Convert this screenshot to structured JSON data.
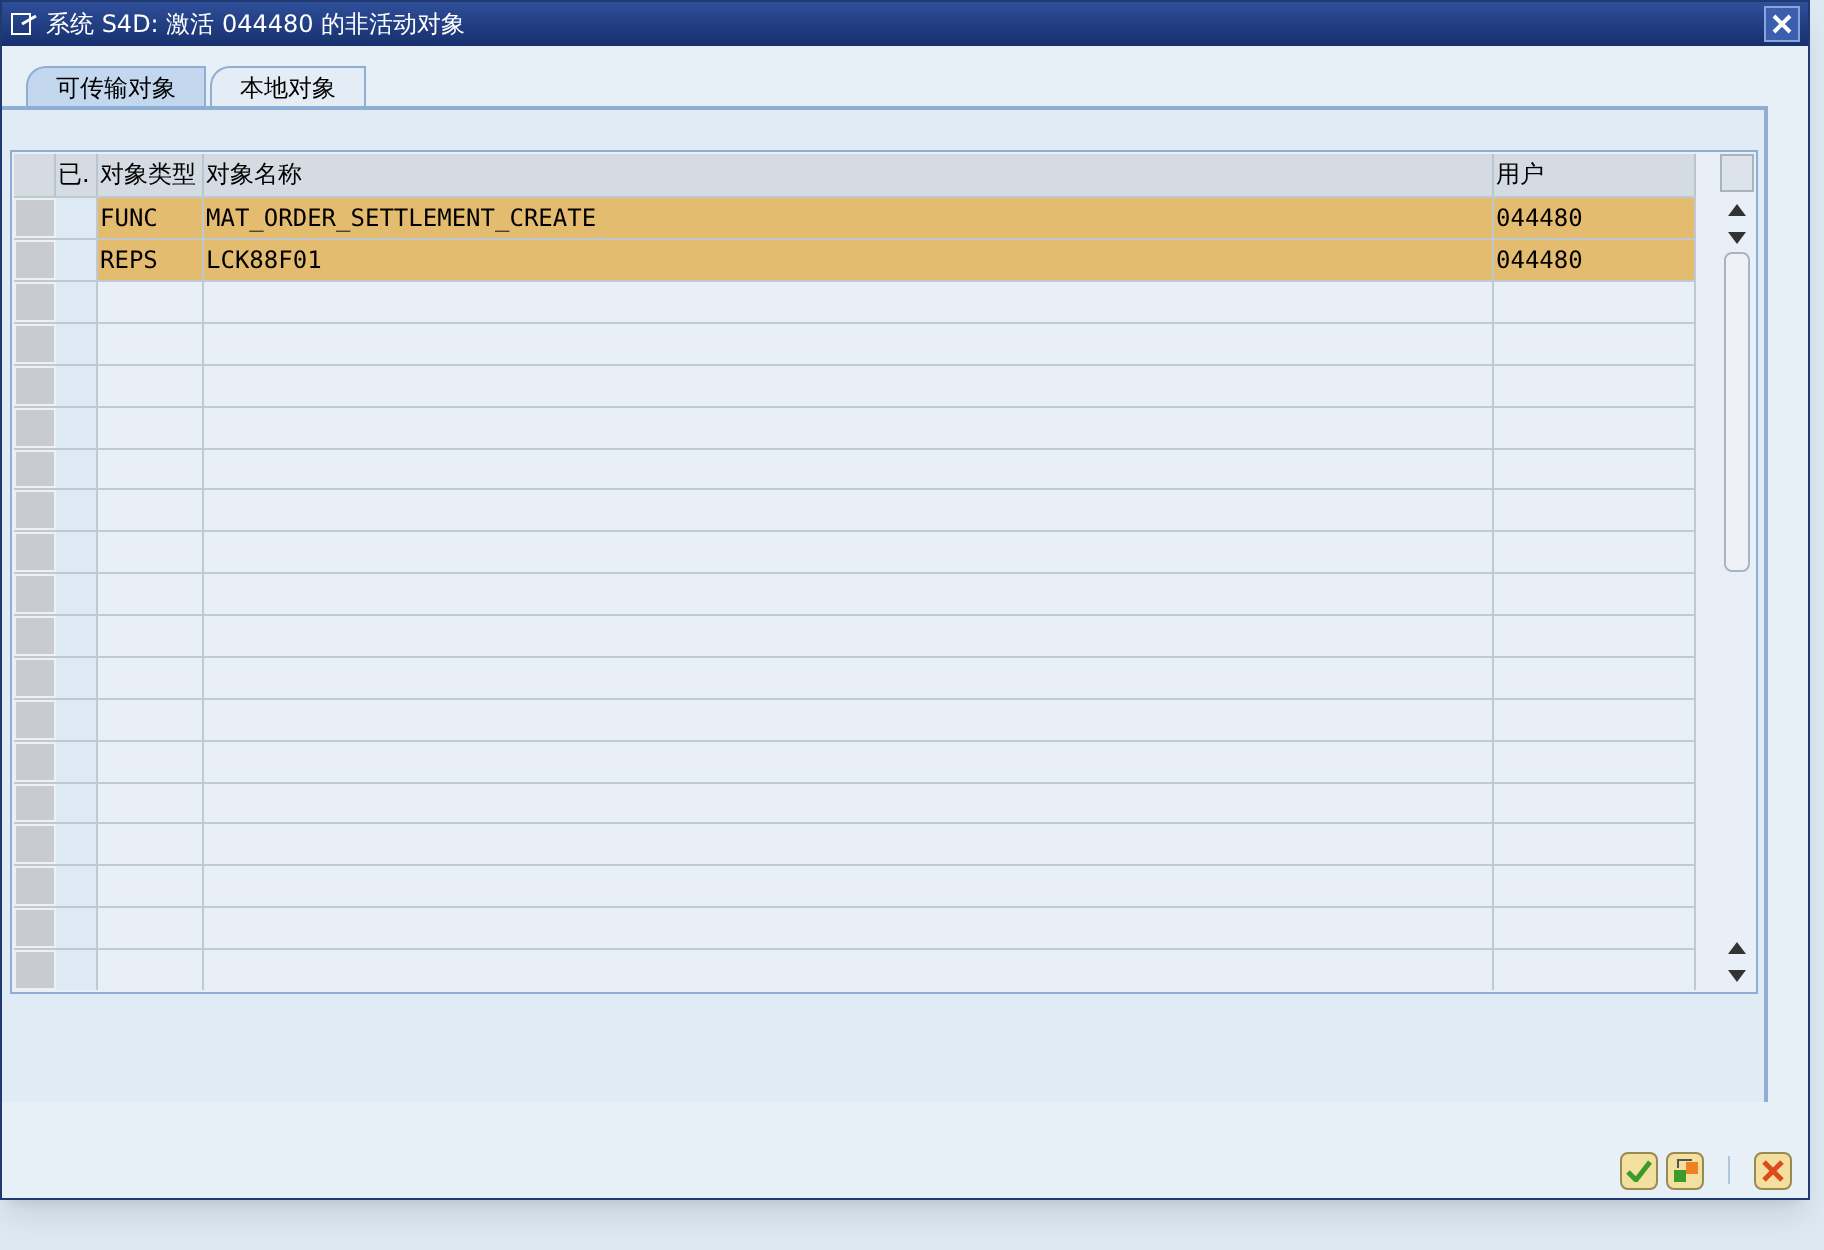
{
  "window": {
    "title": "系统 S4D: 激活 044480 的非活动对象"
  },
  "tabs": [
    {
      "label": "可传输对象",
      "selected": true
    },
    {
      "label": "本地对象",
      "selected": false
    }
  ],
  "table": {
    "columns": [
      "已.",
      "对象类型",
      "对象名称",
      "用户"
    ],
    "rows": [
      {
        "type": "FUNC",
        "name": "MAT_ORDER_SETTLEMENT_CREATE",
        "user": "044480",
        "selected": true
      },
      {
        "type": "REPS",
        "name": "LCK88F01",
        "user": "044480",
        "selected": true
      }
    ]
  }
}
